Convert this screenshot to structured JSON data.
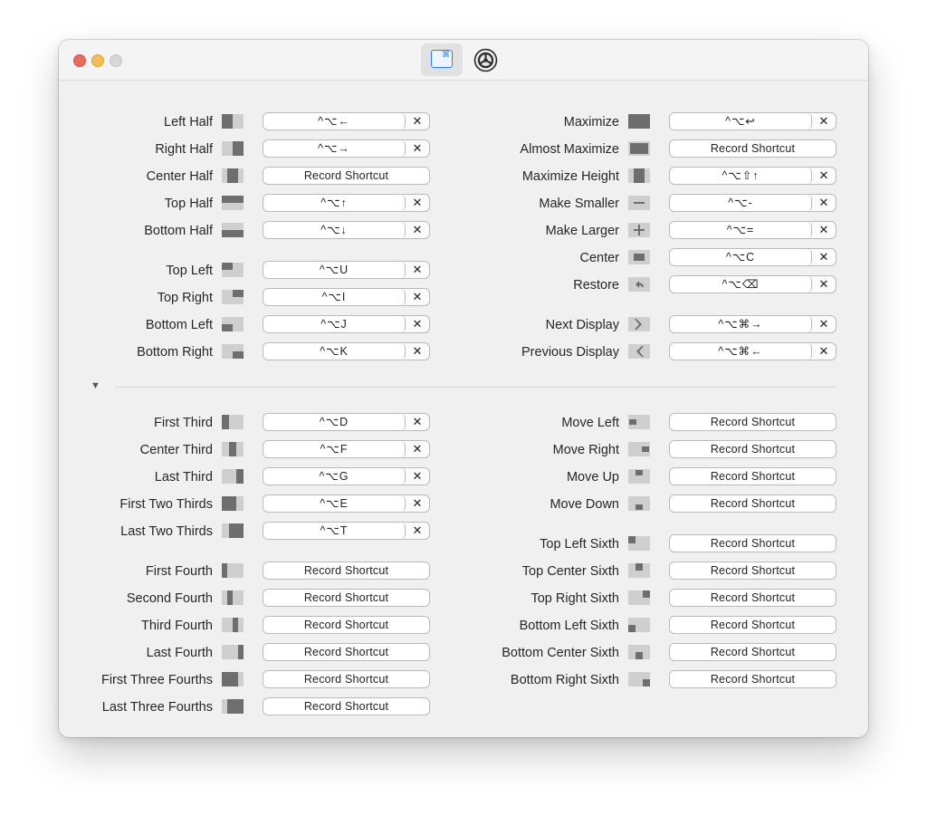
{
  "window": {
    "traffic_lights": [
      "close",
      "minimize",
      "zoom"
    ],
    "toolbar": [
      {
        "name": "keyboard-shortcuts-tab",
        "icon": "keyboard-command-icon",
        "glyph": "⌘",
        "selected": true
      },
      {
        "name": "settings-tab",
        "icon": "gear-icon",
        "selected": false
      }
    ]
  },
  "record_label": "Record Shortcut",
  "sections": {
    "top_left": [
      {
        "label": "Left Half",
        "icon": "left-half",
        "shortcut": "^⌥←"
      },
      {
        "label": "Right Half",
        "icon": "right-half",
        "shortcut": "^⌥→"
      },
      {
        "label": "Center Half",
        "icon": "center-half",
        "shortcut": null
      },
      {
        "label": "Top Half",
        "icon": "top-half",
        "shortcut": "^⌥↑"
      },
      {
        "label": "Bottom Half",
        "icon": "bottom-half",
        "shortcut": "^⌥↓"
      },
      {
        "label": "Top Left",
        "icon": "top-left",
        "shortcut": "^⌥U"
      },
      {
        "label": "Top Right",
        "icon": "top-right",
        "shortcut": "^⌥I"
      },
      {
        "label": "Bottom Left",
        "icon": "bottom-left",
        "shortcut": "^⌥J"
      },
      {
        "label": "Bottom Right",
        "icon": "bottom-right",
        "shortcut": "^⌥K"
      }
    ],
    "top_right": [
      {
        "label": "Maximize",
        "icon": "maximize",
        "shortcut": "^⌥↩"
      },
      {
        "label": "Almost Maximize",
        "icon": "almost-maximize",
        "shortcut": null
      },
      {
        "label": "Maximize Height",
        "icon": "maximize-height",
        "shortcut": "^⌥⇧↑"
      },
      {
        "label": "Make Smaller",
        "icon": "make-smaller",
        "shortcut": "^⌥-"
      },
      {
        "label": "Make Larger",
        "icon": "make-larger",
        "shortcut": "^⌥="
      },
      {
        "label": "Center",
        "icon": "center",
        "shortcut": "^⌥C"
      },
      {
        "label": "Restore",
        "icon": "restore",
        "shortcut": "^⌥⌫"
      },
      {
        "label": "Next Display",
        "icon": "next-display",
        "shortcut": "^⌥⌘→"
      },
      {
        "label": "Previous Display",
        "icon": "previous-display",
        "shortcut": "^⌥⌘←"
      }
    ],
    "bottom_left": [
      {
        "label": "First Third",
        "icon": "first-third",
        "shortcut": "^⌥D"
      },
      {
        "label": "Center Third",
        "icon": "center-third",
        "shortcut": "^⌥F"
      },
      {
        "label": "Last Third",
        "icon": "last-third",
        "shortcut": "^⌥G"
      },
      {
        "label": "First Two Thirds",
        "icon": "first-two-thirds",
        "shortcut": "^⌥E"
      },
      {
        "label": "Last Two Thirds",
        "icon": "last-two-thirds",
        "shortcut": "^⌥T"
      },
      {
        "label": "First Fourth",
        "icon": "first-fourth",
        "shortcut": null
      },
      {
        "label": "Second Fourth",
        "icon": "second-fourth",
        "shortcut": null
      },
      {
        "label": "Third Fourth",
        "icon": "third-fourth",
        "shortcut": null
      },
      {
        "label": "Last Fourth",
        "icon": "last-fourth",
        "shortcut": null
      },
      {
        "label": "First Three Fourths",
        "icon": "first-three-fourths",
        "shortcut": null
      },
      {
        "label": "Last Three Fourths",
        "icon": "last-three-fourths",
        "shortcut": null
      }
    ],
    "bottom_right": [
      {
        "label": "Move Left",
        "icon": "move-left",
        "shortcut": null
      },
      {
        "label": "Move Right",
        "icon": "move-right",
        "shortcut": null
      },
      {
        "label": "Move Up",
        "icon": "move-up",
        "shortcut": null
      },
      {
        "label": "Move Down",
        "icon": "move-down",
        "shortcut": null
      },
      {
        "label": "Top Left Sixth",
        "icon": "top-left-sixth",
        "shortcut": null
      },
      {
        "label": "Top Center Sixth",
        "icon": "top-center-sixth",
        "shortcut": null
      },
      {
        "label": "Top Right Sixth",
        "icon": "top-right-sixth",
        "shortcut": null
      },
      {
        "label": "Bottom Left Sixth",
        "icon": "bottom-left-sixth",
        "shortcut": null
      },
      {
        "label": "Bottom Center Sixth",
        "icon": "bottom-center-sixth",
        "shortcut": null
      },
      {
        "label": "Bottom Right Sixth",
        "icon": "bottom-right-sixth",
        "shortcut": null
      }
    ]
  },
  "clear_glyph": "✕",
  "disclosure_glyph": "▼",
  "colors": {
    "window_bg": "#f0f0f0",
    "icon_dark": "#6e6e6e",
    "icon_light": "#cfcfcf",
    "accent": "#2c7df6",
    "close": "#ed6a5e",
    "minimize": "#f5bf4f",
    "zoom_inactive": "#d7d7d7"
  }
}
